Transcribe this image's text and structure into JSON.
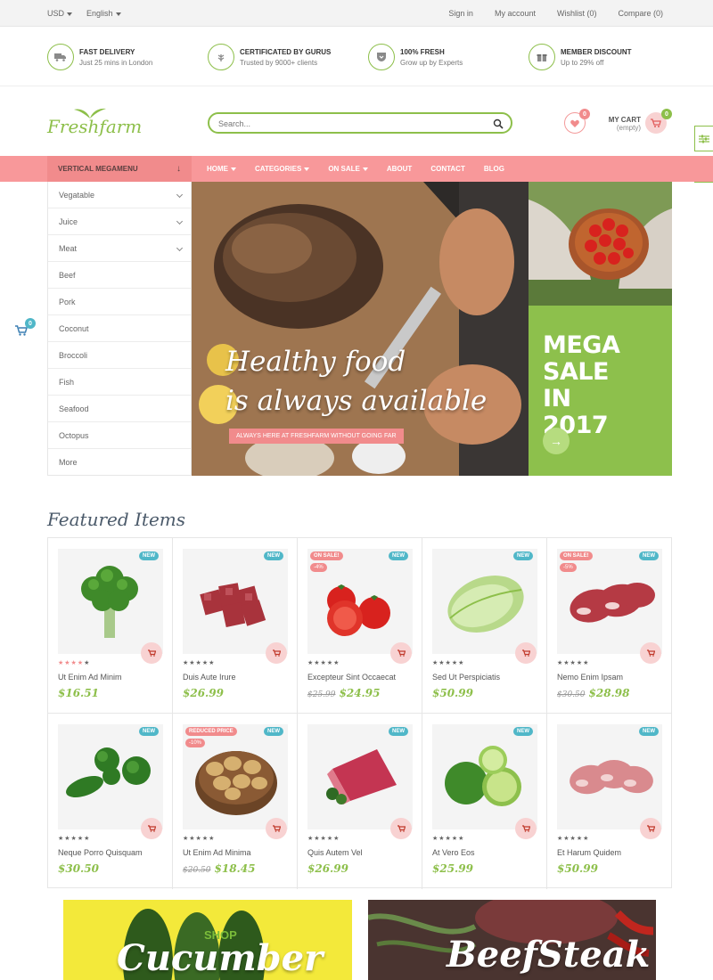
{
  "topbar": {
    "currency": "USD",
    "language": "English",
    "signin": "Sign in",
    "account": "My account",
    "wishlist": "Wishlist (0)",
    "compare": "Compare (0)"
  },
  "features": [
    {
      "title": "FAST DELIVERY",
      "sub": "Just 25 mins in London",
      "icon": "truck-icon"
    },
    {
      "title": "CERTIFICATED BY GURUS",
      "sub": "Trusted by 9000+ clients",
      "icon": "leaf-icon"
    },
    {
      "title": "100% FRESH",
      "sub": "Grow up by Experts",
      "icon": "shield-icon"
    },
    {
      "title": "MEMBER DISCOUNT",
      "sub": "Up to 29% off",
      "icon": "gift-icon"
    }
  ],
  "header": {
    "logo": "Freshfarm",
    "search_placeholder": "Search...",
    "wishlist_count": "0",
    "cart_title": "MY CART",
    "cart_status": "(empty)",
    "cart_count": "0",
    "floating_cart_count": "0"
  },
  "nav": {
    "vertical_menu": "VERTICAL MEGAMENU",
    "links": [
      "HOME",
      "CATEGORIES",
      "ON SALE",
      "ABOUT",
      "CONTACT",
      "BLOG"
    ]
  },
  "vertical_menu_items": [
    "Vegatable",
    "Juice",
    "Meat",
    "Beef",
    "Pork",
    "Coconut",
    "Broccoli",
    "Fish",
    "Seafood",
    "Octopus",
    "More"
  ],
  "hero": {
    "line1": "Healthy food",
    "line2": "is always available",
    "tagline": "ALWAYS HERE AT FRESHFARM WITHOUT GOING FAR",
    "promo_line1": "MEGA SALE",
    "promo_line2": "IN",
    "promo_line3": "2017",
    "promo_button": "→"
  },
  "featured": {
    "title": "Featured Items",
    "products": [
      {
        "name": "Ut Enim Ad Minim",
        "price": "$16.51",
        "old": "",
        "rating": 4,
        "new": "NEW",
        "sale": "",
        "off": ""
      },
      {
        "name": "Duis Aute Irure",
        "price": "$26.99",
        "old": "",
        "rating": 0,
        "new": "NEW",
        "sale": "",
        "off": ""
      },
      {
        "name": "Excepteur Sint Occaecat",
        "price": "$24.95",
        "old": "$25.99",
        "rating": 0,
        "new": "NEW",
        "sale": "ON SALE!",
        "off": "-4%"
      },
      {
        "name": "Sed Ut Perspiciatis",
        "price": "$50.99",
        "old": "",
        "rating": 0,
        "new": "NEW",
        "sale": "",
        "off": ""
      },
      {
        "name": "Nemo Enim Ipsam",
        "price": "$28.98",
        "old": "$30.50",
        "rating": 0,
        "new": "NEW",
        "sale": "ON SALE!",
        "off": "-5%"
      },
      {
        "name": "Neque Porro Quisquam",
        "price": "$30.50",
        "old": "",
        "rating": 0,
        "new": "NEW",
        "sale": "",
        "off": ""
      },
      {
        "name": "Ut Enim Ad Minima",
        "price": "$18.45",
        "old": "$20.50",
        "rating": 0,
        "new": "NEW",
        "sale": "REDUCED PRICE",
        "off": "-10%"
      },
      {
        "name": "Quis Autem Vel",
        "price": "$26.99",
        "old": "",
        "rating": 0,
        "new": "NEW",
        "sale": "",
        "off": ""
      },
      {
        "name": "At Vero Eos",
        "price": "$25.99",
        "old": "",
        "rating": 0,
        "new": "NEW",
        "sale": "",
        "off": ""
      },
      {
        "name": "Et Harum Quidem",
        "price": "$50.99",
        "old": "",
        "rating": 0,
        "new": "NEW",
        "sale": "",
        "off": ""
      }
    ]
  },
  "banners": {
    "left_small": "SHOP",
    "left_big": "Cucumber",
    "right_big": "BeefSteak"
  },
  "colors": {
    "accent_green": "#8dbf4a",
    "accent_pink": "#f8989a",
    "badge_blue": "#50b7c8"
  }
}
